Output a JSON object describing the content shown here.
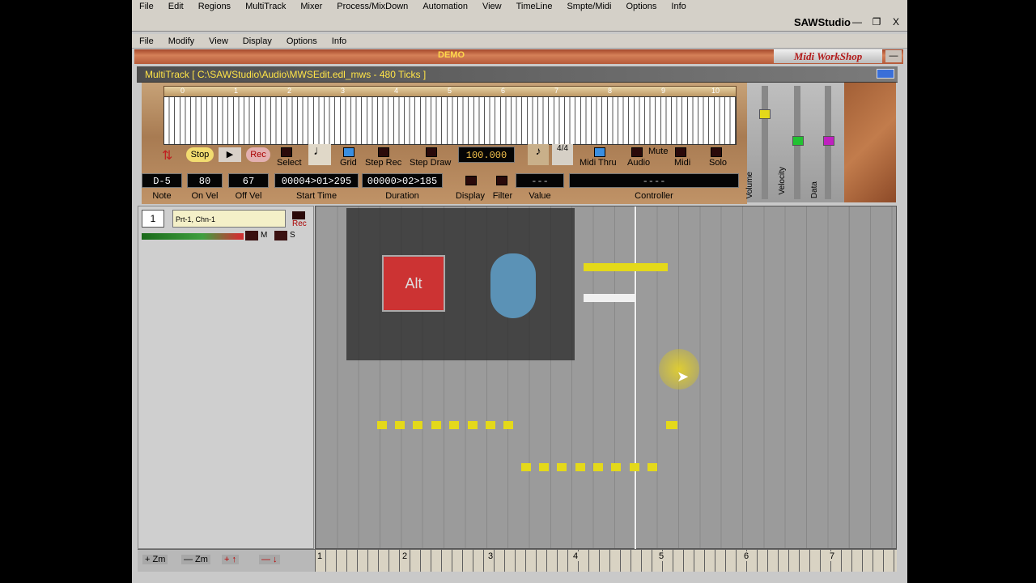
{
  "top_menu": [
    "File",
    "Edit",
    "Regions",
    "MultiTrack",
    "Mixer",
    "Process/MixDown",
    "Automation",
    "View",
    "TimeLine",
    "Smpte/Midi",
    "Options",
    "Info"
  ],
  "app_title": "SAWStudio",
  "window_buttons": [
    "—",
    "❐",
    "X"
  ],
  "sub_menu": [
    "File",
    "Modify",
    "View",
    "Display",
    "Options",
    "Info"
  ],
  "banner": {
    "demo": "DEMO",
    "plugin_name": "Midi WorkShop",
    "close": "—"
  },
  "multitrack_title": "MultiTrack [ C:\\SAWStudio\\Audio\\MWSEdit.edl_mws - 480 Ticks ]",
  "keyboard_ruler": [
    "0",
    "1",
    "2",
    "3",
    "4",
    "5",
    "6",
    "7",
    "8",
    "9",
    "10"
  ],
  "transport": {
    "stop": "Stop",
    "play": "▶",
    "rec": "Rec"
  },
  "tools": {
    "select": "Select",
    "grid": "Grid",
    "step_rec": "Step Rec",
    "step_draw": "Step Draw",
    "tempo": "100.000",
    "midi_thru": "Midi Thru",
    "mute": "Mute",
    "audio": "Audio",
    "midi": "Midi",
    "solo": "Solo"
  },
  "fields": {
    "note": "D-5",
    "on_vel": "80",
    "off_vel": "67",
    "start_time": "00004>01>295",
    "duration": "00000>02>185",
    "value": "---",
    "controller": "----"
  },
  "field_labels": {
    "note": "Note",
    "on_vel": "On Vel",
    "off_vel": "Off Vel",
    "start_time": "Start Time",
    "duration": "Duration",
    "display": "Display",
    "filter": "Filter",
    "value": "Value",
    "controller": "Controller"
  },
  "fader_labels": [
    "Volume",
    "Velocity",
    "Data"
  ],
  "track": {
    "number": "1",
    "name": "Prt-1, Chn-1",
    "rec": "Rec",
    "m": "M",
    "s": "S"
  },
  "overlay": {
    "alt_key": "Alt"
  },
  "bottom_buttons": [
    "+ Zm",
    "— Zm",
    "+ ↑",
    "— ↓"
  ],
  "timeline_marks": [
    "1",
    "2",
    "3",
    "4",
    "5",
    "6",
    "7"
  ],
  "colors": {
    "note": "#e4d91a",
    "title_text": "#ffe447",
    "wood": "#b07a4f"
  }
}
